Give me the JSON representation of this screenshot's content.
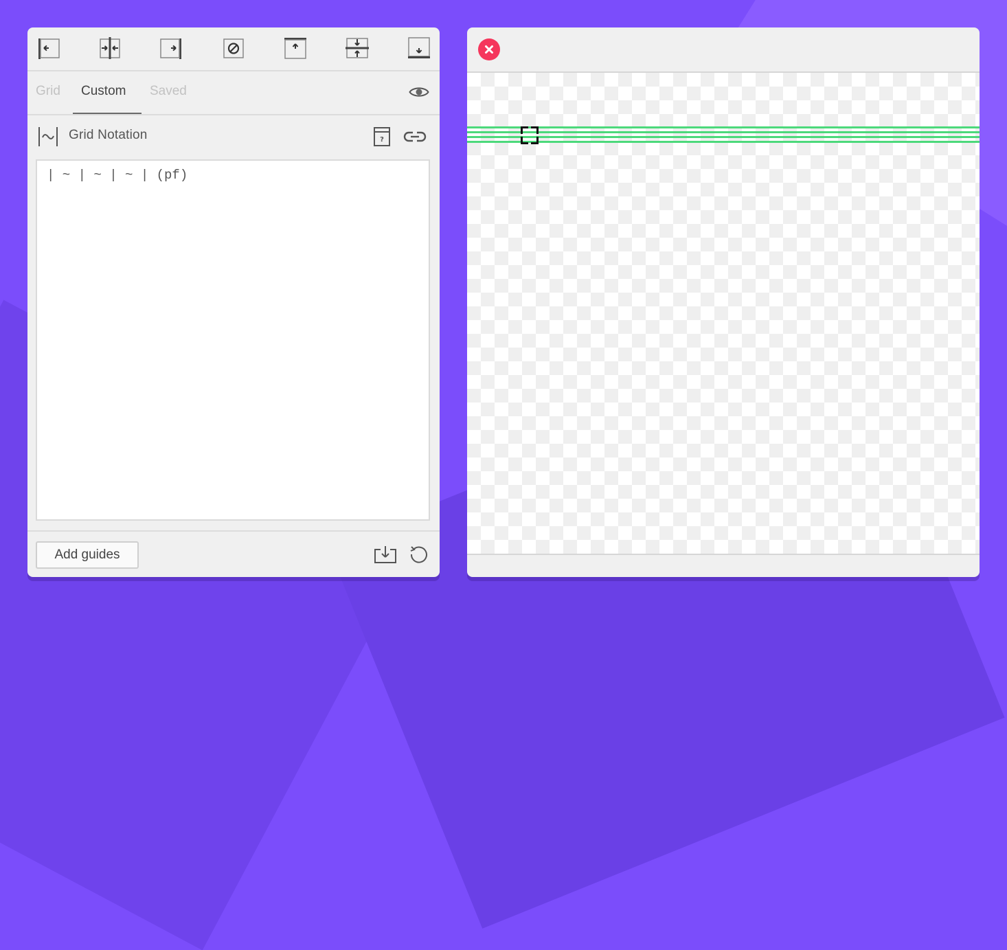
{
  "toolbar": {
    "tools": [
      {
        "name": "align-left",
        "icon": "align-left-edge-icon"
      },
      {
        "name": "align-center-vertical",
        "icon": "align-vertical-center-icon"
      },
      {
        "name": "align-right",
        "icon": "align-right-edge-icon"
      },
      {
        "name": "no-alignment",
        "icon": "prohibited-icon"
      },
      {
        "name": "align-top",
        "icon": "align-top-edge-icon"
      },
      {
        "name": "align-middle-horizontal",
        "icon": "align-horizontal-center-icon"
      },
      {
        "name": "align-bottom",
        "icon": "align-bottom-edge-icon"
      }
    ]
  },
  "tabs": [
    {
      "label": "Grid",
      "active": false
    },
    {
      "label": "Custom",
      "active": true
    },
    {
      "label": "Saved",
      "active": false
    }
  ],
  "section": {
    "title": "Grid Notation",
    "icon": "grid-notation-icon",
    "help_icon": "help-book-icon",
    "link_icon": "link-icon"
  },
  "editor": {
    "value": "| ~ | ~ | ~ | (pf)"
  },
  "footer": {
    "add_label": "Add guides",
    "save_icon": "save-download-icon",
    "reset_icon": "reset-icon"
  },
  "canvas": {
    "close_icon": "close-icon",
    "guide_color": "#4cd97b"
  },
  "colors": {
    "background": "#7b4dfb",
    "close_button": "#f5365c",
    "active_tab": "#444444",
    "inactive_tab": "#c2c2c2"
  }
}
